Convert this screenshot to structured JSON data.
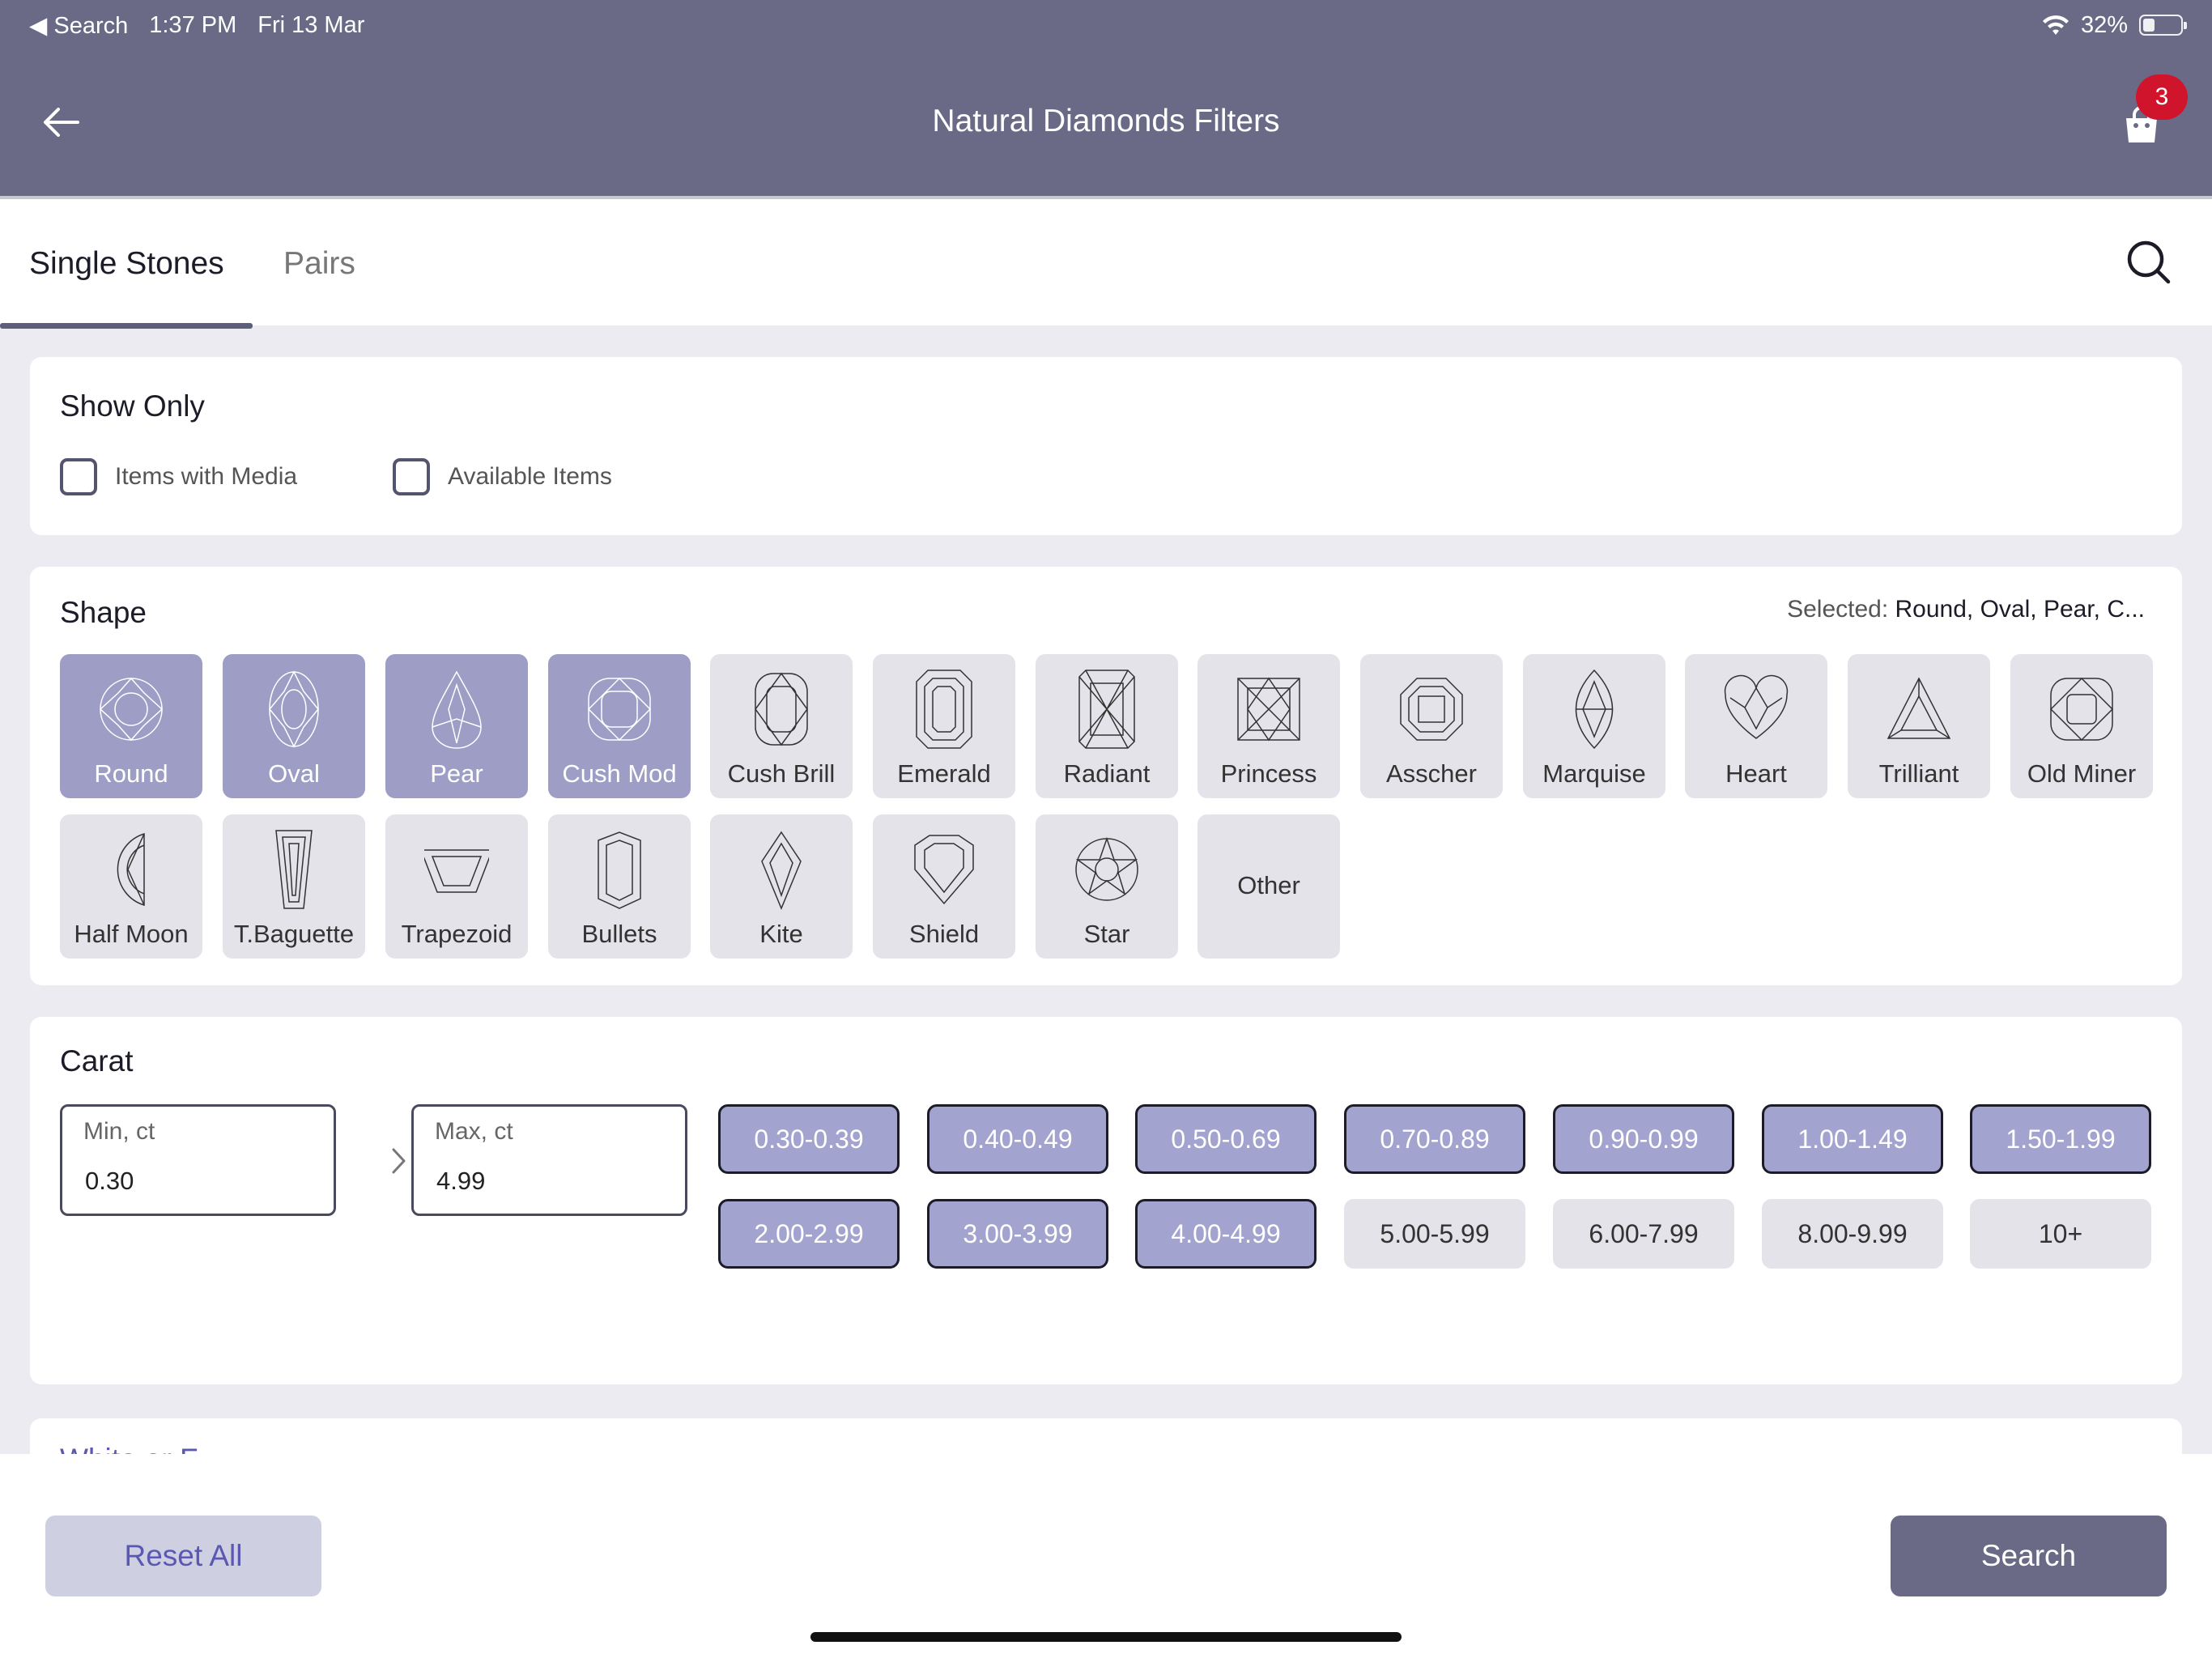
{
  "status_bar": {
    "back_app": "◀ Search",
    "time": "1:37 PM",
    "date": "Fri 13 Mar",
    "battery": "32%"
  },
  "header": {
    "title": "Natural Diamonds Filters",
    "cart_count": "3"
  },
  "tabs": [
    {
      "label": "Single Stones",
      "active": true
    },
    {
      "label": "Pairs",
      "active": false
    }
  ],
  "show_only": {
    "title": "Show Only",
    "options": [
      {
        "label": "Items with Media",
        "checked": false
      },
      {
        "label": "Available Items",
        "checked": false
      }
    ]
  },
  "shape": {
    "title": "Shape",
    "selected_prefix": "Selected:",
    "selected_value": "Round, Oval, Pear, C...",
    "items": [
      {
        "label": "Round",
        "icon": "round-diamond-icon",
        "selected": true
      },
      {
        "label": "Oval",
        "icon": "oval-diamond-icon",
        "selected": true
      },
      {
        "label": "Pear",
        "icon": "pear-diamond-icon",
        "selected": true
      },
      {
        "label": "Cush Mod",
        "icon": "cushion-modified-diamond-icon",
        "selected": true
      },
      {
        "label": "Cush Brill",
        "icon": "cushion-brilliant-diamond-icon",
        "selected": false
      },
      {
        "label": "Emerald",
        "icon": "emerald-diamond-icon",
        "selected": false
      },
      {
        "label": "Radiant",
        "icon": "radiant-diamond-icon",
        "selected": false
      },
      {
        "label": "Princess",
        "icon": "princess-diamond-icon",
        "selected": false
      },
      {
        "label": "Asscher",
        "icon": "asscher-diamond-icon",
        "selected": false
      },
      {
        "label": "Marquise",
        "icon": "marquise-diamond-icon",
        "selected": false
      },
      {
        "label": "Heart",
        "icon": "heart-diamond-icon",
        "selected": false
      },
      {
        "label": "Trilliant",
        "icon": "trilliant-diamond-icon",
        "selected": false
      },
      {
        "label": "Old Miner",
        "icon": "old-miner-diamond-icon",
        "selected": false
      },
      {
        "label": "Half Moon",
        "icon": "half-moon-diamond-icon",
        "selected": false
      },
      {
        "label": "T.Baguette",
        "icon": "tapered-baguette-diamond-icon",
        "selected": false
      },
      {
        "label": "Trapezoid",
        "icon": "trapezoid-diamond-icon",
        "selected": false
      },
      {
        "label": "Bullets",
        "icon": "bullet-diamond-icon",
        "selected": false
      },
      {
        "label": "Kite",
        "icon": "kite-diamond-icon",
        "selected": false
      },
      {
        "label": "Shield",
        "icon": "shield-diamond-icon",
        "selected": false
      },
      {
        "label": "Star",
        "icon": "star-diamond-icon",
        "selected": false
      },
      {
        "label": "Other",
        "icon": "",
        "selected": false
      }
    ]
  },
  "carat": {
    "title": "Carat",
    "min": {
      "placeholder": "Min, ct",
      "value": "0.30"
    },
    "max": {
      "placeholder": "Max, ct",
      "value": "4.99"
    },
    "ranges": [
      {
        "label": "0.30-0.39",
        "selected": true
      },
      {
        "label": "0.40-0.49",
        "selected": true
      },
      {
        "label": "0.50-0.69",
        "selected": true
      },
      {
        "label": "0.70-0.89",
        "selected": true
      },
      {
        "label": "0.90-0.99",
        "selected": true
      },
      {
        "label": "1.00-1.49",
        "selected": true
      },
      {
        "label": "1.50-1.99",
        "selected": true
      },
      {
        "label": "2.00-2.99",
        "selected": true
      },
      {
        "label": "3.00-3.99",
        "selected": true
      },
      {
        "label": "4.00-4.99",
        "selected": true
      },
      {
        "label": "5.00-5.99",
        "selected": false
      },
      {
        "label": "6.00-7.99",
        "selected": false
      },
      {
        "label": "8.00-9.99",
        "selected": false
      },
      {
        "label": "10+",
        "selected": false
      }
    ]
  },
  "next_section_peek": "White or F",
  "footer": {
    "reset_label": "Reset All",
    "search_label": "Search"
  },
  "colors": {
    "accent": "#6a6a87",
    "selected": "#9d9dc6",
    "badge": "#d0142b",
    "link": "#5a58b2"
  }
}
